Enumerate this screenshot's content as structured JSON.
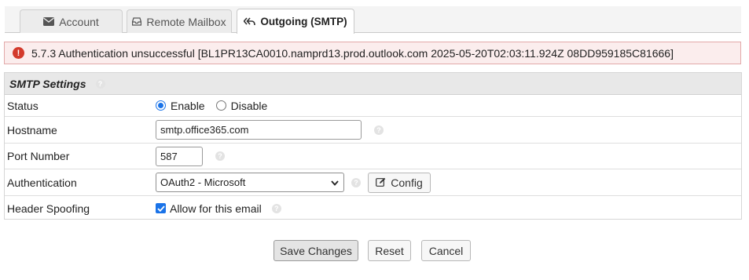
{
  "tabs": [
    {
      "label": "Account",
      "icon": "envelope-icon"
    },
    {
      "label": "Remote Mailbox",
      "icon": "inbox-tray-icon"
    },
    {
      "label": "Outgoing (SMTP)",
      "icon": "reply-all-icon",
      "active": true
    }
  ],
  "alert": {
    "icon": "exclamation-circle-icon",
    "message": "5.7.3 Authentication unsuccessful [BL1PR13CA0010.namprd13.prod.outlook.com 2025-05-20T02:03:11.924Z 08DD959185C81666]",
    "color": "#d33a2c"
  },
  "panel": {
    "title": "SMTP Settings",
    "rows": {
      "status": {
        "label": "Status",
        "enable": "Enable",
        "disable": "Disable",
        "selected": "Enable"
      },
      "hostname": {
        "label": "Hostname",
        "value": "smtp.office365.com"
      },
      "port": {
        "label": "Port Number",
        "value": "587"
      },
      "auth": {
        "label": "Authentication",
        "selected": "OAuth2 - Microsoft",
        "config_label": "Config"
      },
      "spoofing": {
        "label": "Header Spoofing",
        "checkbox_label": "Allow for this email",
        "checked": true
      }
    }
  },
  "actions": {
    "save": "Save Changes",
    "reset": "Reset",
    "cancel": "Cancel"
  },
  "colors": {
    "accent": "#1a73e8",
    "alert_bg": "#fbeded",
    "alert_border": "#e2a9a9"
  }
}
